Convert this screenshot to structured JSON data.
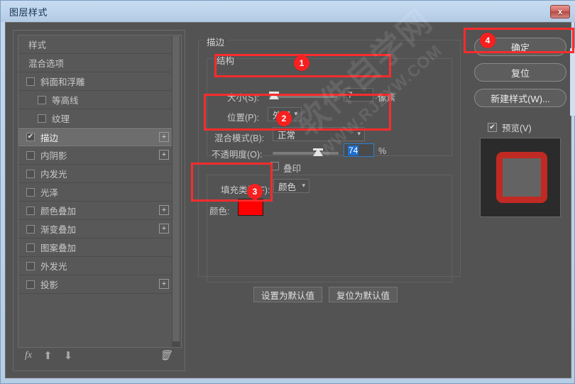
{
  "window": {
    "title": "图层样式",
    "close_label": "x"
  },
  "styles_panel": {
    "items": [
      {
        "label": "样式",
        "type": "plain",
        "checked": false,
        "has_plus": false,
        "selected": false,
        "indent": false
      },
      {
        "label": "混合选项",
        "type": "plain",
        "checked": false,
        "has_plus": false,
        "selected": false,
        "indent": false
      },
      {
        "label": "斜面和浮雕",
        "type": "check",
        "checked": false,
        "has_plus": false,
        "selected": false,
        "indent": false
      },
      {
        "label": "等高线",
        "type": "check",
        "checked": false,
        "has_plus": false,
        "selected": false,
        "indent": true
      },
      {
        "label": "纹理",
        "type": "check",
        "checked": false,
        "has_plus": false,
        "selected": false,
        "indent": true
      },
      {
        "label": "描边",
        "type": "check",
        "checked": true,
        "has_plus": true,
        "selected": true,
        "indent": false
      },
      {
        "label": "内阴影",
        "type": "check",
        "checked": false,
        "has_plus": true,
        "selected": false,
        "indent": false
      },
      {
        "label": "内发光",
        "type": "check",
        "checked": false,
        "has_plus": false,
        "selected": false,
        "indent": false
      },
      {
        "label": "光泽",
        "type": "check",
        "checked": false,
        "has_plus": false,
        "selected": false,
        "indent": false
      },
      {
        "label": "颜色叠加",
        "type": "check",
        "checked": false,
        "has_plus": true,
        "selected": false,
        "indent": false
      },
      {
        "label": "渐变叠加",
        "type": "check",
        "checked": false,
        "has_plus": true,
        "selected": false,
        "indent": false
      },
      {
        "label": "图案叠加",
        "type": "check",
        "checked": false,
        "has_plus": false,
        "selected": false,
        "indent": false
      },
      {
        "label": "外发光",
        "type": "check",
        "checked": false,
        "has_plus": false,
        "selected": false,
        "indent": false
      },
      {
        "label": "投影",
        "type": "check",
        "checked": false,
        "has_plus": true,
        "selected": false,
        "indent": false
      }
    ],
    "toolbar": {
      "fx_icon": "fx-icon",
      "up_icon": "arrow-up-icon",
      "down_icon": "arrow-down-icon",
      "trash_icon": "trash-icon",
      "fx_glyph": "fx",
      "up_glyph": "⬆",
      "down_glyph": "⬇",
      "trash_glyph": "🗑"
    },
    "checked_glyph": "✔"
  },
  "settings": {
    "heading": "描边",
    "structure": {
      "legend": "结构",
      "size": {
        "label": "大小(S):",
        "value": "7",
        "unit": "像素",
        "slider_percent": 6
      },
      "position": {
        "label": "位置(P):",
        "value": "外部"
      },
      "blend_mode": {
        "label": "混合模式(B):",
        "value": "正常"
      },
      "opacity": {
        "label": "不透明度(O):",
        "value": "74",
        "unit": "%",
        "slider_percent": 74
      },
      "overprint": {
        "label": "叠印",
        "checked": false
      }
    },
    "fill_type": {
      "label": "填充类型(F):",
      "value": "颜色"
    },
    "color": {
      "label": "颜色:",
      "hex": "#fe0000"
    },
    "buttons": {
      "set_default": "设置为默认值",
      "reset_default": "复位为默认值"
    }
  },
  "right_pane": {
    "ok": "确定",
    "reset": "复位",
    "new_style": "新建样式(W)...",
    "preview": {
      "label": "预览(V)",
      "checked": true,
      "glyph": "✔"
    }
  },
  "annotations": {
    "badges": [
      {
        "number": "1"
      },
      {
        "number": "2"
      },
      {
        "number": "3"
      },
      {
        "number": "4"
      }
    ],
    "highlight_color": "#fb2c2c"
  },
  "watermark": {
    "main": "软件自学网",
    "sub": "WWW.RJZXW.COM"
  }
}
